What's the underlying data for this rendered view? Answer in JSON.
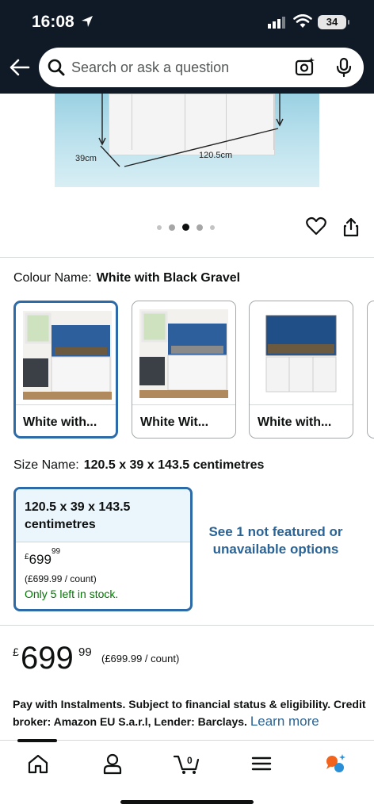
{
  "status_bar": {
    "time": "16:08",
    "battery": "34"
  },
  "search": {
    "placeholder": "Search or ask a question"
  },
  "product_image": {
    "dim_depth": "39cm",
    "dim_width": "120.5cm"
  },
  "carousel": {
    "count": 5,
    "active": 2
  },
  "colour": {
    "label": "Colour Name:",
    "value": "White with Black Gravel",
    "options": [
      {
        "label": "White with...",
        "selected": true
      },
      {
        "label": "White Wit...",
        "selected": false
      },
      {
        "label": "White with...",
        "selected": false
      }
    ]
  },
  "size": {
    "label": "Size Name:",
    "value": "120.5 x 39 x 143.5 centimetres",
    "card": {
      "title": "120.5 x 39 x 143.5 centimetres",
      "currency": "£",
      "price_whole": "699",
      "price_fraction": "99",
      "unit_price": "(£699.99 / count)",
      "stock": "Only 5 left in stock."
    },
    "see_more": "See 1 not featured or unavailable options"
  },
  "price": {
    "currency": "£",
    "whole": "699",
    "fraction": "99",
    "unit_price": "(£699.99 / count)"
  },
  "instalments": {
    "text": "Pay with Instalments. Subject to financial status & eligibility. Credit broker: Amazon EU S.a.r.l, Lender: Barclays.",
    "link": "Learn more"
  },
  "nav": {
    "cart_count": "0"
  },
  "colors": {
    "header_bg": "#101a26",
    "selected_border": "#2c6aa8",
    "link": "#2a6496",
    "stock_green": "#007600"
  }
}
